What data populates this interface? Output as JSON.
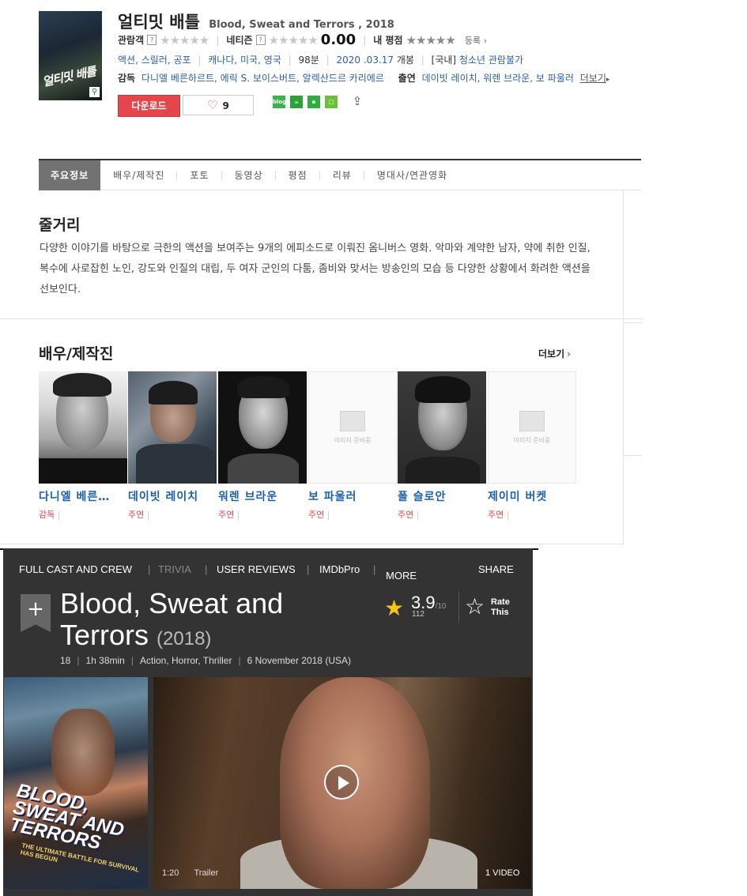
{
  "naver": {
    "title": "얼티밋 배틀",
    "subtitle": "Blood, Sweat and Terrors , 2018",
    "poster_text": "얼티밋 배틀",
    "audience_label": "관람객",
    "netizen_label": "네티즌",
    "netizen_score": "0.00",
    "my_rating_label": "내 평점",
    "register_label": "등록",
    "genres": "액션, 스릴러, 공포",
    "countries": "캐나다, 미국, 영국",
    "runtime": "98분",
    "release_date": "2020 .03.17",
    "release_suffix": "개봉",
    "rating_prefix": "[국내]",
    "rating_text": "청소년 관람불가",
    "director_label": "감독",
    "directors": "다니엘 베른하르트, 에릭 S. 보이스버트, 알렉산드르 카리에르",
    "cast_label": "출연",
    "cast_list": "데이빗 레이치, 워렌 브라운, 보 파울러",
    "more_link": "더보기",
    "download_label": "다운로드",
    "like_count": "9",
    "sns": [
      "blog",
      "cafe",
      "",
      ""
    ],
    "tabs": [
      "주요정보",
      "배우/제작진",
      "포토",
      "동영상",
      "평점",
      "리뷰",
      "명대사/연관영화"
    ],
    "synopsis_title": "줄거리",
    "synopsis": "다양한 이야기를 바탕으로 극한의 액션을 보여주는 9개의 에피소드로 이뤄진 옴니버스 영화. 악마와 계약한 남자, 약에 취한 인질, 복수에 사로잡힌 노인, 강도와 인질의 대립, 두 여자 군인의 다툼, 좀비와 맞서는 방송인의 모습 등 다양한 상황에서 화려한 액션을 선보인다.",
    "cast_title": "배우/제작진",
    "cast_more": "더보기",
    "placeholder_text": "이미지 준비중",
    "people": [
      {
        "name": "다니엘 베른…",
        "role": "감독",
        "photo": true
      },
      {
        "name": "데이빗 레이치",
        "role": "주연",
        "photo": true
      },
      {
        "name": "워렌 브라운",
        "role": "주연",
        "photo": true
      },
      {
        "name": "보 파울러",
        "role": "주연",
        "photo": false
      },
      {
        "name": "폴 슬로안",
        "role": "주연",
        "photo": true
      },
      {
        "name": "제이미 버켓",
        "role": "주연",
        "photo": false
      }
    ]
  },
  "imdb": {
    "nav": [
      "FULL CAST AND CREW",
      "TRIVIA",
      "USER REVIEWS",
      "IMDbPro",
      "MORE",
      "SHARE"
    ],
    "title": "Blood, Sweat and Terrors",
    "year": "(2018)",
    "meta": [
      "18",
      "1h 38min",
      "Action, Horror, Thriller",
      "6 November 2018 (USA)"
    ],
    "rating": "3.9",
    "rating_out_of": "/10",
    "votes": "112",
    "rate_this": "Rate This",
    "poster_title": "BLOOD, SWEAT AND TERRORS",
    "poster_tagline": "THE ULTIMATE BATTLE FOR SURVIVAL HAS BEGUN",
    "video_duration": "1:20",
    "video_label": "Trailer",
    "video_count": "1 VIDEO"
  },
  "colors": {
    "naver_red": "#e4464b",
    "naver_link": "#2d5fa3",
    "imdb_bg": "#333333",
    "imdb_star": "#f5c518"
  }
}
